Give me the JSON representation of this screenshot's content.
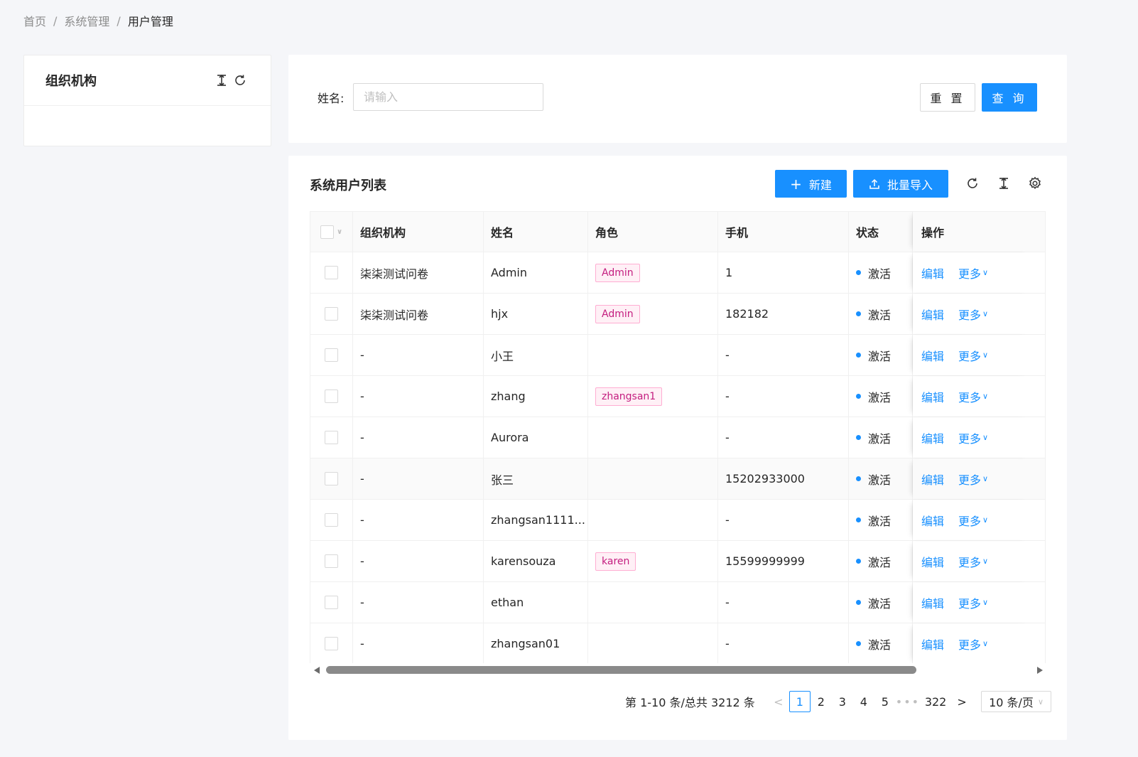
{
  "breadcrumb": {
    "home": "首页",
    "system": "系统管理",
    "current": "用户管理",
    "separator": "/"
  },
  "org_panel": {
    "title": "组织机构"
  },
  "search": {
    "label": "姓名:",
    "placeholder": "请输入",
    "reset_label": "重 置",
    "query_label": "查 询"
  },
  "list": {
    "title": "系统用户列表",
    "new_label": "新建",
    "import_label": "批量导入",
    "columns": {
      "org": "组织机构",
      "name": "姓名",
      "role": "角色",
      "phone": "手机",
      "status": "状态",
      "op": "操作"
    },
    "edit_label": "编辑",
    "more_label": "更多",
    "rows": [
      {
        "org": "柒柒测试问卷",
        "name": "Admin",
        "role": "Admin",
        "phone": "1",
        "status": "激活"
      },
      {
        "org": "柒柒测试问卷",
        "name": "hjx",
        "role": "Admin",
        "phone": "182182",
        "status": "激活"
      },
      {
        "org": "-",
        "name": "小王",
        "role": "",
        "phone": "-",
        "status": "激活"
      },
      {
        "org": "-",
        "name": "zhang",
        "role": "zhangsan1",
        "phone": "-",
        "status": "激活"
      },
      {
        "org": "-",
        "name": "Aurora",
        "role": "",
        "phone": "-",
        "status": "激活"
      },
      {
        "org": "-",
        "name": "张三",
        "role": "",
        "phone": "15202933000",
        "status": "激活"
      },
      {
        "org": "-",
        "name": "zhangsan1111...",
        "role": "",
        "phone": "-",
        "status": "激活"
      },
      {
        "org": "-",
        "name": "karensouza",
        "role": "karen",
        "phone": "15599999999",
        "status": "激活"
      },
      {
        "org": "-",
        "name": "ethan",
        "role": "",
        "phone": "-",
        "status": "激活"
      },
      {
        "org": "-",
        "name": "zhangsan01",
        "role": "",
        "phone": "-",
        "status": "激活"
      }
    ]
  },
  "pagination": {
    "total_text": "第 1-10 条/总共 3212 条",
    "prev": "<",
    "pages": [
      "1",
      "2",
      "3",
      "4",
      "5"
    ],
    "ellipsis": "•••",
    "last_page": "322",
    "next": ">",
    "page_size": "10 条/页"
  },
  "colors": {
    "primary": "#1890ff",
    "tag_text": "#c41d7f",
    "tag_bg": "#fff0f6",
    "tag_border": "#ffadd2"
  },
  "icons": {
    "vertical_align": "vertical-align-middle-icon",
    "reload": "reload-icon",
    "settings": "gear-icon",
    "plus": "plus-icon",
    "upload": "upload-icon"
  }
}
